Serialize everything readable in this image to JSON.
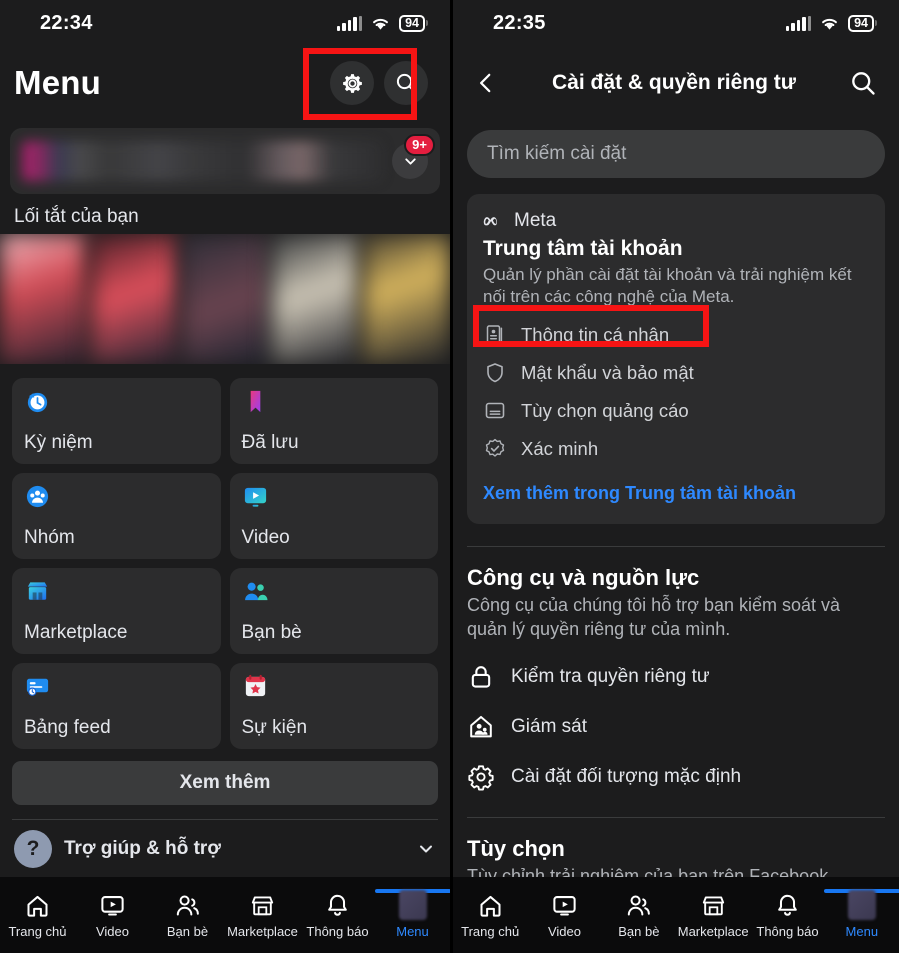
{
  "left": {
    "status": {
      "time": "22:34",
      "battery": "94",
      "signal_icon": "cellular-bars-icon",
      "wifi_icon": "wifi-icon"
    },
    "header": {
      "title": "Menu",
      "settings_icon": "gear-icon",
      "search_icon": "search-icon"
    },
    "profile": {
      "badge": "9+",
      "chevron_icon": "chevron-down-icon"
    },
    "shortcuts_title": "Lối tắt của bạn",
    "tiles": [
      {
        "label": "Kỳ niệm",
        "icon": "memories-clock-icon"
      },
      {
        "label": "Đã lưu",
        "icon": "bookmark-icon"
      },
      {
        "label": "Nhóm",
        "icon": "groups-icon"
      },
      {
        "label": "Video",
        "icon": "video-icon"
      },
      {
        "label": "Marketplace",
        "icon": "marketplace-icon"
      },
      {
        "label": "Bạn bè",
        "icon": "friends-icon"
      },
      {
        "label": "Bảng feed",
        "icon": "feeds-icon"
      },
      {
        "label": "Sự kiện",
        "icon": "events-calendar-icon"
      }
    ],
    "see_more": "Xem thêm",
    "help": {
      "label": "Trợ giúp & hỗ trợ",
      "icon": "question-mark-icon",
      "chevron_icon": "chevron-down-icon"
    }
  },
  "right": {
    "status": {
      "time": "22:35",
      "battery": "94",
      "signal_icon": "cellular-bars-icon",
      "wifi_icon": "wifi-icon"
    },
    "header": {
      "back_icon": "chevron-left-icon",
      "title": "Cài đặt & quyền riêng tư",
      "search_icon": "search-icon"
    },
    "search": {
      "placeholder": "Tìm kiếm cài đặt"
    },
    "account_center": {
      "brand": "Meta",
      "brand_icon": "meta-infinity-icon",
      "title": "Trung tâm tài khoản",
      "description": "Quản lý phần cài đặt tài khoản và trải nghiệm kết nối trên các công nghệ của Meta.",
      "items": [
        {
          "label": "Thông tin cá nhân",
          "icon": "personal-details-icon",
          "highlighted": true
        },
        {
          "label": "Mật khẩu và bảo mật",
          "icon": "shield-icon",
          "highlighted": false
        },
        {
          "label": "Tùy chọn quảng cáo",
          "icon": "ad-preferences-icon",
          "highlighted": false
        },
        {
          "label": "Xác minh",
          "icon": "verified-badge-icon",
          "highlighted": false
        }
      ],
      "link": "Xem thêm trong Trung tâm tài khoản"
    },
    "tools": {
      "title": "Công cụ và nguồn lực",
      "description": "Công cụ của chúng tôi hỗ trợ bạn kiểm soát và quản lý quyền riêng tư của mình.",
      "items": [
        {
          "label": "Kiểm tra quyền riêng tư",
          "icon": "lock-icon"
        },
        {
          "label": "Giám sát",
          "icon": "supervision-home-icon"
        },
        {
          "label": "Cài đặt đối tượng mặc định",
          "icon": "gear-icon"
        }
      ]
    },
    "preferences": {
      "title": "Tùy chọn",
      "description": "Tùy chỉnh trải nghiệm của bạn trên Facebook"
    }
  },
  "bottom_nav": [
    {
      "label": "Trang chủ",
      "icon": "home-icon",
      "active": false
    },
    {
      "label": "Video",
      "icon": "video-icon",
      "active": false
    },
    {
      "label": "Bạn bè",
      "icon": "friends-icon",
      "active": false
    },
    {
      "label": "Marketplace",
      "icon": "marketplace-icon",
      "active": false
    },
    {
      "label": "Thông báo",
      "icon": "bell-icon",
      "active": false
    },
    {
      "label": "Menu",
      "icon": "avatar-icon",
      "active": true
    }
  ],
  "annotations": {
    "highlight_color": "#f61414",
    "boxes": [
      {
        "target": "gear-icon",
        "panel": "left"
      },
      {
        "target": "personal-details-item",
        "panel": "right"
      }
    ]
  },
  "colors": {
    "accent": "#2e89ff",
    "badge": "#e41e3f",
    "card": "#2c2c2d",
    "background": "#1c1c1d"
  }
}
